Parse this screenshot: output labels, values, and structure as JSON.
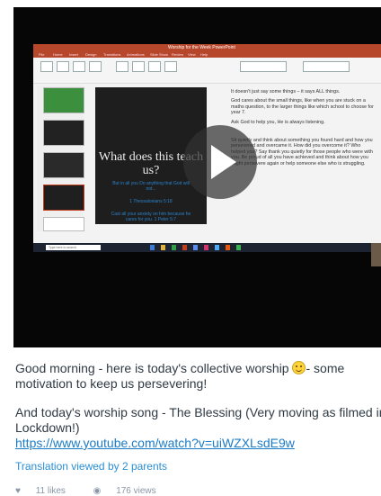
{
  "video": {
    "app_title": "Worship for the Week PowerPoint",
    "ribbon_tabs": [
      "File",
      "Home",
      "Insert",
      "Design",
      "Transitions",
      "Animations",
      "Slide Show",
      "Review",
      "View",
      "Help"
    ],
    "slide_heading": "What does this teach us?",
    "slide_blue_1": "But in all you Do anything that God will not...",
    "slide_blue_2": "1 Thessalonians 5:18",
    "slide_blue_3": "Cast all your anxiety on him because he cares for you. 1 Peter 5:7",
    "notes": [
      "It doesn't just say some things – it says ALL things.",
      "God cares about the small things, like when you are stuck on a maths question, to the larger things like which school to choose for year 7.",
      "Ask God to help you, He is always listening.",
      "Sit quietly and think about something you found hard and how you persevered and overcame it. How did you overcome it? Who helped you? Say thank you quietly for those people who were with you. Be proud of all you have achieved and think about how you might persevere again or help someone else who is struggling."
    ],
    "taskbar_search": "Type here to search",
    "play_label": "Play video"
  },
  "post": {
    "line1": "Good morning - here is today's collective worship",
    "line1_after": "- some",
    "line2": "motivation to keep us persevering!",
    "line3": "And today's worship song - The Blessing (Very moving as filmed in",
    "line4": "Lockdown!)",
    "link": "https://www.youtube.com/watch?v=uiWZXLsdE9w",
    "translation": "Translation viewed by 2 parents",
    "likes": "11 likes",
    "views": "176 views"
  },
  "colors": {
    "accent": "#1a7bc7",
    "text": "#2f3a44",
    "ppt_red": "#b7472a",
    "emoji": "#ffd43b"
  }
}
